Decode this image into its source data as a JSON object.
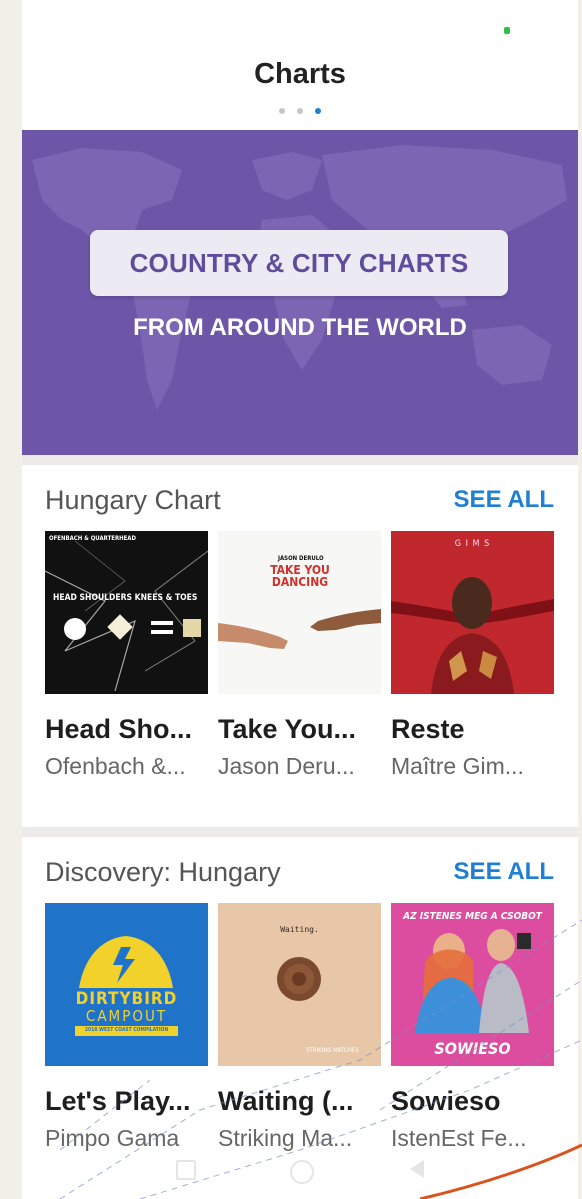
{
  "header": {
    "title": "Charts",
    "pager_count": 3,
    "pager_active": 2
  },
  "banner": {
    "headline": "COUNTRY & CITY CHARTS",
    "subline": "FROM AROUND THE WORLD"
  },
  "sections": [
    {
      "title": "Hungary Chart",
      "see_all": "SEE ALL",
      "items": [
        {
          "title": "Head Sho...",
          "subtitle": "Ofenbach &...",
          "art_text": [
            "OFENBACH & QUARTERHEAD",
            "HEAD SHOULDERS KNEES & TOES"
          ]
        },
        {
          "title": "Take You...",
          "subtitle": "Jason Deru...",
          "art_text": [
            "JASON DERULO",
            "TAKE YOU DANCING"
          ]
        },
        {
          "title": "Reste",
          "subtitle": "Maître Gim...",
          "art_text": [
            "G I M S"
          ]
        }
      ]
    },
    {
      "title": "Discovery: Hungary",
      "see_all": "SEE ALL",
      "items": [
        {
          "title": "Let's Play...",
          "subtitle": "Pimpo Gama",
          "art_text": [
            "DIRTYBIRD",
            "CAMPOUT",
            "2018 WEST COAST COMPILATION"
          ]
        },
        {
          "title": "Waiting (...",
          "subtitle": "Striking Ma...",
          "art_text": [
            "Waiting.",
            "STRIKING MATCHES"
          ]
        },
        {
          "title": "Sowieso",
          "subtitle": "IstenEst Fe...",
          "art_text": [
            "AZ ISTENES MEG A CSOBOT",
            "SOWIESO"
          ]
        }
      ]
    }
  ],
  "colors": {
    "accent": "#1f7fd2",
    "banner": "#6d55a8",
    "pager_active": "#1e7fd0",
    "overlay_stroke": "#d9531e"
  }
}
